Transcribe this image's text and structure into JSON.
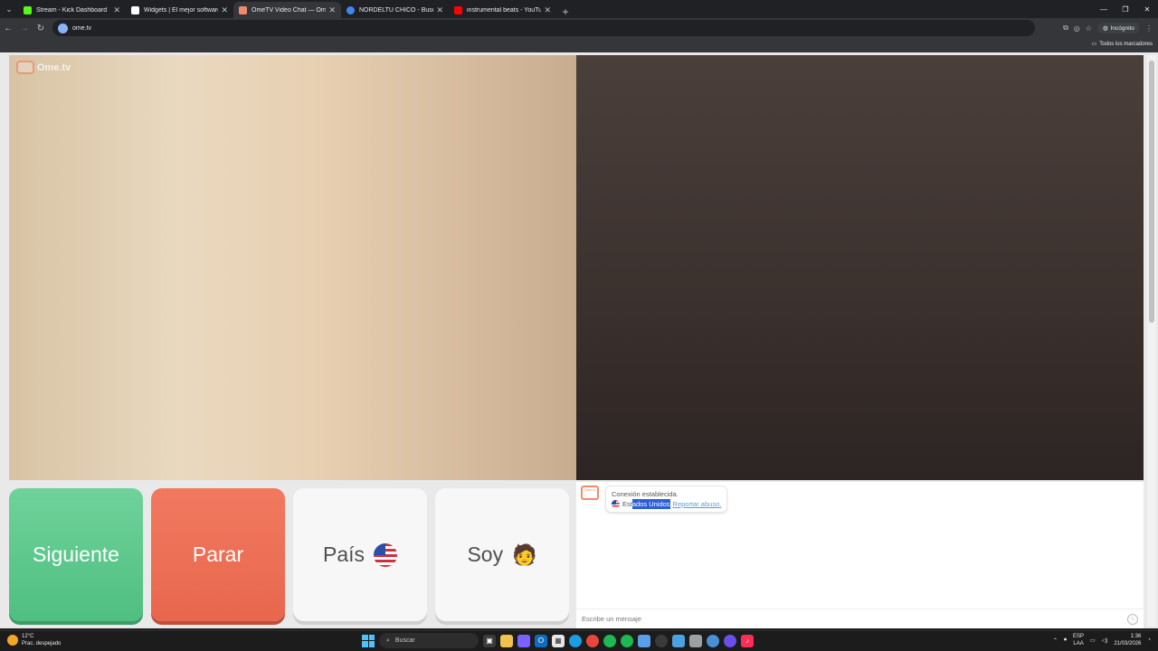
{
  "browser": {
    "tabs": [
      {
        "title": "Stream - Kick Dashboard",
        "favicon_color": "#53fc18",
        "active": false
      },
      {
        "title": "Widgets | El mejor software pa",
        "favicon_color": "#ffffff",
        "active": false
      },
      {
        "title": "OmeTV Video Chat — Ome",
        "favicon_color": "#f08a6a",
        "active": true
      },
      {
        "title": "NORDELTU CHICO - Buscar co",
        "favicon_color": "#4285f4",
        "active": false
      },
      {
        "title": "instrumental beats - YouTube",
        "favicon_color": "#ff0000",
        "active": false
      }
    ],
    "url": "ome.tv",
    "incognito_label": "Incógnito",
    "bookmarks_label": "Todos los marcadores"
  },
  "ometv": {
    "logo_text": "Ome.tv",
    "buttons": {
      "next": "Siguiente",
      "stop": "Parar",
      "country": "País",
      "me": "Soy"
    },
    "me_emoji": "🧑",
    "chat": {
      "avatar_text": "Ome tv",
      "status": "Conexión establecida.",
      "country_prefix": "Est",
      "country_selected": "ados Unidos",
      "report": "Reportar abuso.",
      "placeholder": "Escribe un mensaje"
    }
  },
  "taskbar": {
    "temperature": "12°C",
    "weather": "Prac. despejado",
    "search_placeholder": "Buscar",
    "lang_primary": "ESP",
    "lang_secondary": "LAA",
    "time": "1:36",
    "date": "21/03/2026"
  }
}
